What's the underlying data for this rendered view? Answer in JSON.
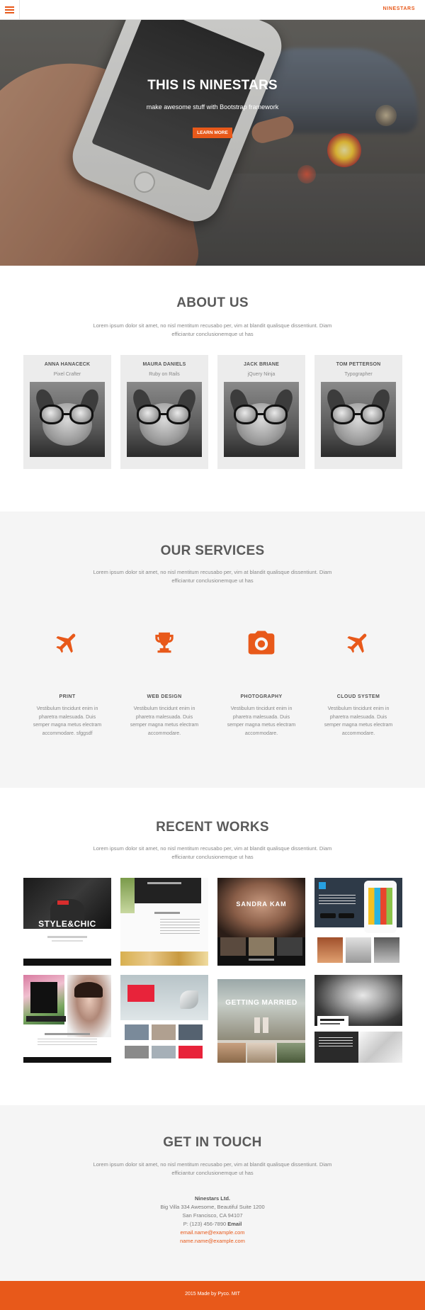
{
  "nav": {
    "brand": "NINESTARS",
    "menu_icon": "hamburger-icon"
  },
  "hero": {
    "title": "THIS IS NINESTARS",
    "subtitle": "make awesome stuff with Bootstrap framework",
    "button": "LEARN MORE"
  },
  "about": {
    "title": "ABOUT US",
    "text": "Lorem ipsum dolor sit amet, no nisl mentitum recusabo per, vim at blandit qualisque dissentiunt. Diam efficiantur conclusionemque ut has",
    "members": [
      {
        "name": "ANNA HANACECK",
        "role": "Pixel Crafter"
      },
      {
        "name": "MAURA DANIELS",
        "role": "Ruby on Rails"
      },
      {
        "name": "JACK BRIANE",
        "role": "jQuery Ninja"
      },
      {
        "name": "TOM PETTERSON",
        "role": "Typographer"
      }
    ]
  },
  "services": {
    "title": "OUR SERVICES",
    "text": "Lorem ipsum dolor sit amet, no nisl mentitum recusabo per, vim at blandit qualisque dissentiunt. Diam efficiantur conclusionemque ut has",
    "items": [
      {
        "title": "PRINT",
        "icon": "plane-icon",
        "desc": "Vestibulum tincidunt enim in pharetra malesuada. Duis semper magna metus electram accommodare. sfggsdf"
      },
      {
        "title": "WEB DESIGN",
        "icon": "trophy-icon",
        "desc": "Vestibulum tincidunt enim in pharetra malesuada. Duis semper magna metus electram accommodare."
      },
      {
        "title": "PHOTOGRAPHY",
        "icon": "camera-icon",
        "desc": "Vestibulum tincidunt enim in pharetra malesuada. Duis semper magna metus electram accommodare."
      },
      {
        "title": "CLOUD SYSTEM",
        "icon": "plane-icon",
        "desc": "Vestibulum tincidunt enim in pharetra malesuada. Duis semper magna metus electram accommodare."
      }
    ]
  },
  "works": {
    "title": "RECENT WORKS",
    "text": "Lorem ipsum dolor sit amet, no nisl mentitum recusabo per, vim at blandit qualisque dissentiunt. Diam efficiantur conclusionemque ut has",
    "items": [
      {
        "label": "STYLE&CHIC"
      },
      {
        "label": ""
      },
      {
        "label": "SANDRA KAM"
      },
      {
        "label": ""
      },
      {
        "label": ""
      },
      {
        "label": ""
      },
      {
        "label": "GETTING MARRIED"
      },
      {
        "label": ""
      }
    ]
  },
  "contact": {
    "title": "GET IN TOUCH",
    "text": "Lorem ipsum dolor sit amet, no nisl mentitum recusabo per, vim at blandit qualisque dissentiunt. Diam efficiantur conclusionemque ut has",
    "company": "Ninestars Ltd.",
    "address1": "Big Villa 334 Awesome, Beautiful Suite 1200",
    "address2": "San Francisco, CA 94107",
    "phone_prefix": "P: (123) 456-7890",
    "email_label": "Email",
    "email1": "email.name@example.com",
    "email2": "name.name@example.com"
  },
  "footer": {
    "text": "2015 Made by Pyco. MIT"
  },
  "colors": {
    "accent": "#e8591a",
    "light_bg": "#f5f5f5",
    "card_bg": "#ececec"
  }
}
